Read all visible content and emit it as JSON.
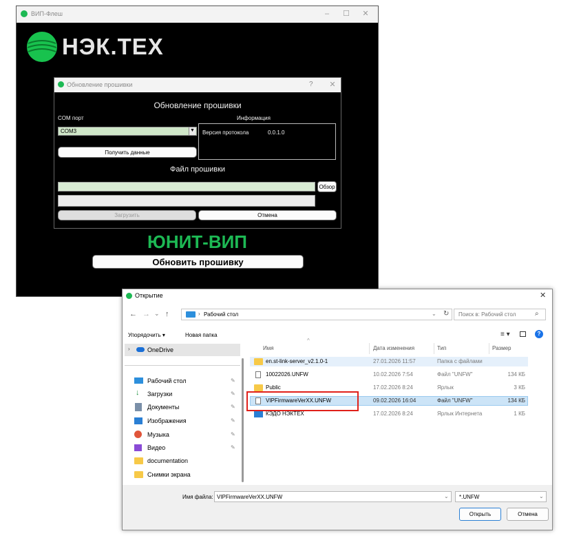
{
  "app": {
    "title": "ВИП-Флеш",
    "logo_text": "НЭК.ТЕХ",
    "device_name": "ЮНИТ-ВИП",
    "update_button": "Обновить прошивку",
    "colors": {
      "accent_green": "#1db954",
      "background": "#000000"
    }
  },
  "firmware_dialog": {
    "title": "Обновление прошивки",
    "help": "?",
    "heading": "Обновление прошивки",
    "com_label": "COM порт",
    "com_value": "COM3",
    "info_label": "Информация",
    "protocol_label": "Версия протокола",
    "protocol_value": "0.0.1.0",
    "get_data_button": "Получить данные",
    "firmware_file_label": "Файл прошивки",
    "browse_button": "Обзор",
    "upload_button": "Загрузить",
    "cancel_button": "Отмена"
  },
  "open_dialog": {
    "title": "Открытие",
    "breadcrumb": "Рабочий стол",
    "search_placeholder": "Поиск в: Рабочий стол",
    "organize": "Упорядочить",
    "new_folder": "Новая папка",
    "columns": {
      "name": "Имя",
      "date": "Дата изменения",
      "type": "Тип",
      "size": "Размер"
    },
    "nav": {
      "onedrive": "OneDrive",
      "items": [
        "Рабочий стол",
        "Загрузки",
        "Документы",
        "Изображения",
        "Музыка",
        "Видео",
        "documentation",
        "Снимки экрана"
      ]
    },
    "files": [
      {
        "name": "en.st-link-server_v2.1.0-1",
        "date": "27.01.2026 11:57",
        "type": "Папка с файлами",
        "size": ""
      },
      {
        "name": "10022026.UNFW",
        "date": "10.02.2026 7:54",
        "type": "Файл \"UNFW\"",
        "size": "134 КБ"
      },
      {
        "name": "Public",
        "date": "17.02.2026 8:24",
        "type": "Ярлык",
        "size": "3 КБ"
      },
      {
        "name": "VIPFirmwareVerXX.UNFW",
        "date": "09.02.2026 16:04",
        "type": "Файл \"UNFW\"",
        "size": "134 КБ"
      },
      {
        "name": "КЭДО НЭКТЕХ",
        "date": "17.02.2026 8:24",
        "type": "Ярлык Интернета",
        "size": "1 КБ"
      }
    ],
    "filename_label": "Имя файла:",
    "filename_value": "VIPFirmwareVerXX.UNFW",
    "filter_value": "*.UNFW",
    "open_button": "Открыть",
    "cancel_button": "Отмена",
    "highlight_color": "#e0201a"
  }
}
